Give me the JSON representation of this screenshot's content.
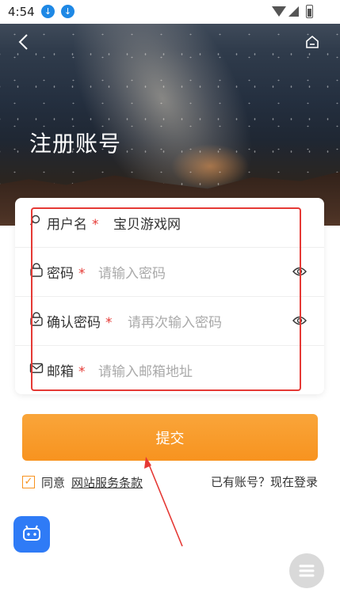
{
  "status_bar": {
    "time": "4:54",
    "icons": [
      "download-icon",
      "download-icon",
      "wifi-icon",
      "signal-icon",
      "battery-icon"
    ]
  },
  "header": {
    "title": "注册账号",
    "back_icon": "back-chevron-icon",
    "home_icon": "home-icon"
  },
  "form": {
    "fields": [
      {
        "label": "用户名",
        "required": "*",
        "value": "宝贝游戏网",
        "placeholder": "",
        "icon": "search-icon"
      },
      {
        "label": "密码",
        "required": "*",
        "value": "",
        "placeholder": "请输入密码",
        "icon": "lock-icon"
      },
      {
        "label": "确认密码",
        "required": "*",
        "value": "",
        "placeholder": "请再次输入密码",
        "icon": "lock-check-icon"
      },
      {
        "label": "邮箱",
        "required": "*",
        "value": "",
        "placeholder": "请输入邮箱地址",
        "icon": "mail-icon"
      }
    ]
  },
  "submit_label": "提交",
  "agreement": {
    "prefix": "同意",
    "link": "网站服务条款",
    "checked": true
  },
  "login_prompt": "已有账号？现在登录",
  "colors": {
    "accent": "#f8931f",
    "required": "#e53935",
    "bot_button": "#2f7bf6"
  }
}
